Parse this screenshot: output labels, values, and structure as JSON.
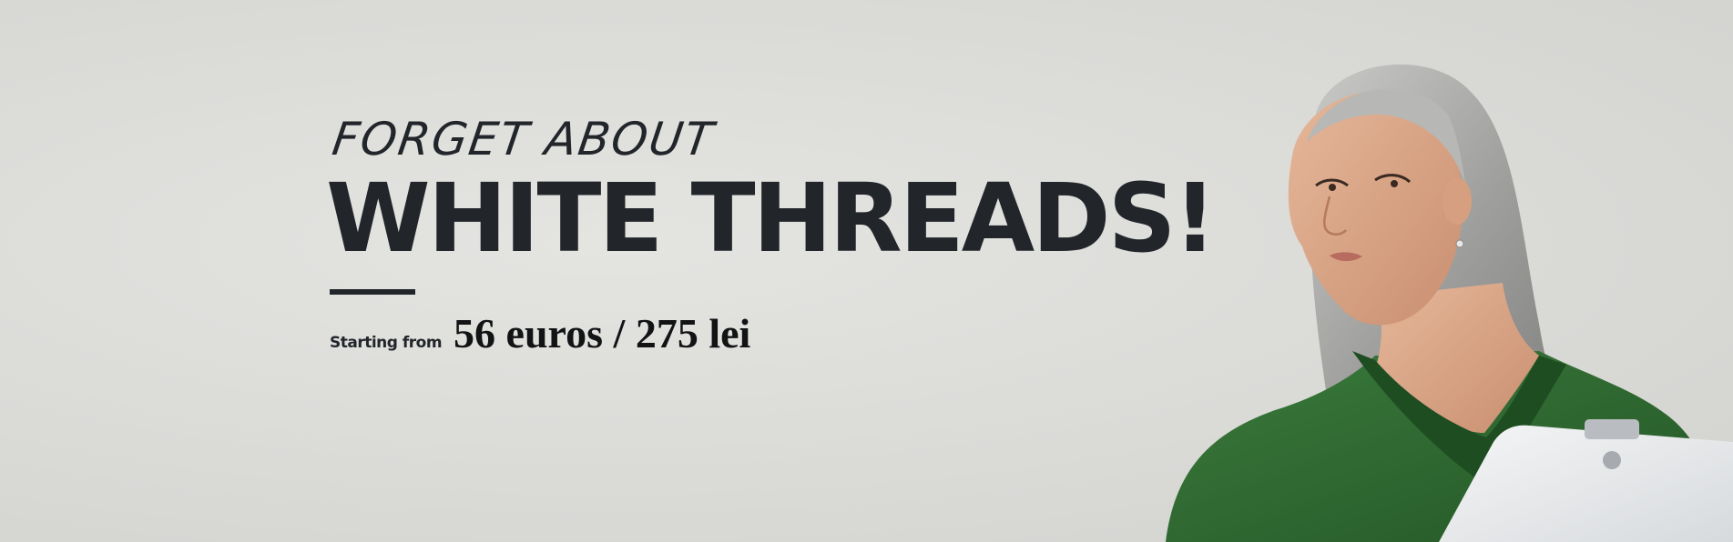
{
  "banner": {
    "kicker": "FORGET ABOUT",
    "headline": "WHITE THREADS!",
    "starting_label": "Starting from",
    "price": "56 euros / 275 lei"
  },
  "colors": {
    "background": "#dcdcd9",
    "text": "#22262b",
    "sweater": "#2f6a32",
    "hair": "#a9a9a9"
  }
}
